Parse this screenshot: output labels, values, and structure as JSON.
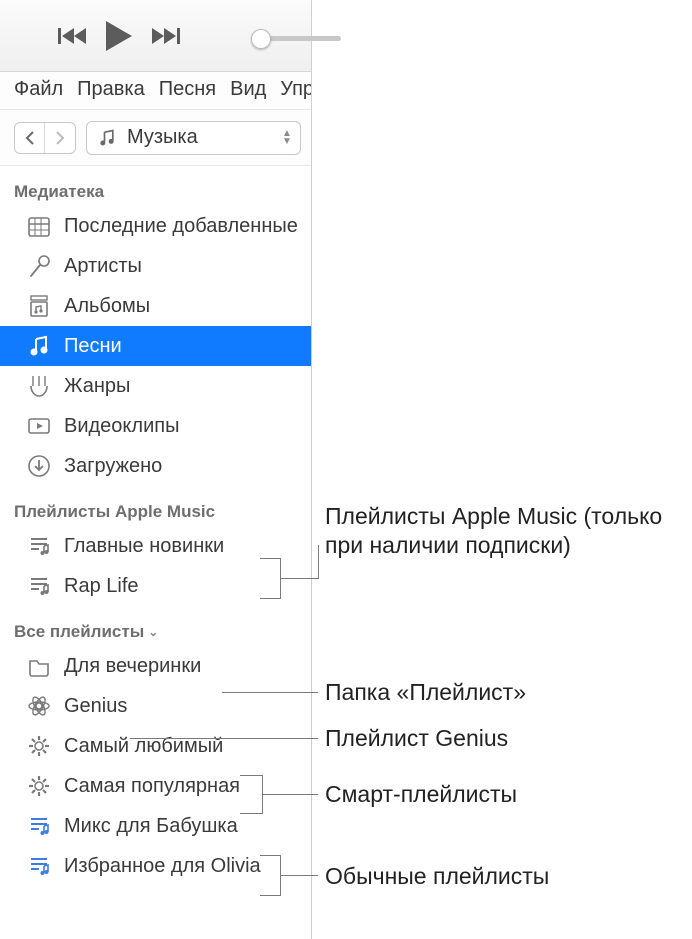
{
  "menubar": [
    "Файл",
    "Правка",
    "Песня",
    "Вид",
    "Упр"
  ],
  "library_select_label": "Музыка",
  "sections": {
    "library_header": "Медиатека",
    "library": [
      {
        "label": "Последние добавленные",
        "icon": "calendar",
        "selected": false
      },
      {
        "label": "Артисты",
        "icon": "mic",
        "selected": false
      },
      {
        "label": "Альбомы",
        "icon": "album",
        "selected": false
      },
      {
        "label": "Песни",
        "icon": "note",
        "selected": true
      },
      {
        "label": "Жанры",
        "icon": "guitar",
        "selected": false
      },
      {
        "label": "Видеоклипы",
        "icon": "video",
        "selected": false
      },
      {
        "label": "Загружено",
        "icon": "download",
        "selected": false
      }
    ],
    "apple_header": "Плейлисты Apple Music",
    "apple": [
      {
        "label": "Главные новинки",
        "icon": "playlist-am"
      },
      {
        "label": "Rap Life",
        "icon": "playlist-am"
      }
    ],
    "all_header": "Все плейлисты",
    "all": [
      {
        "label": "Для вечеринки",
        "icon": "folder"
      },
      {
        "label": "Genius",
        "icon": "genius"
      },
      {
        "label": "Самый любимый",
        "icon": "gear"
      },
      {
        "label": "Самая популярная",
        "icon": "gear"
      },
      {
        "label": "Микс для Бабушка",
        "icon": "playlist"
      },
      {
        "label": "Избранное для Olivia",
        "icon": "playlist"
      }
    ]
  },
  "annotations": {
    "apple": "Плейлисты Apple Music (только при наличии подписки)",
    "folder": "Папка «Плейлист»",
    "genius": "Плейлист Genius",
    "smart": "Смарт-плейлисты",
    "regular": "Обычные плейлисты"
  }
}
